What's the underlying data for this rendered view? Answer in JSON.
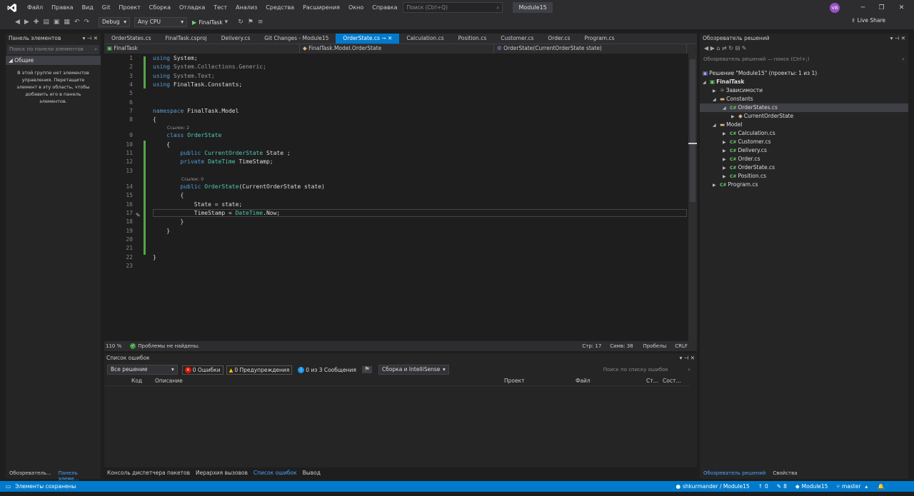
{
  "menu": [
    "Файл",
    "Правка",
    "Вид",
    "Git",
    "Проект",
    "Сборка",
    "Отладка",
    "Тест",
    "Анализ",
    "Средства",
    "Расширения",
    "Окно",
    "Справка"
  ],
  "search_placeholder": "Поиск (Ctrl+Q)",
  "solution_name": "Module15",
  "user_initials": "VB",
  "toolbar": {
    "config": "Debug",
    "platform": "Any CPU",
    "run_target": "FinalTask",
    "live_share": "Live Share"
  },
  "toolbox": {
    "title": "Панель элементов",
    "search_placeholder": "Поиск по панели элементов",
    "group": "Общие",
    "empty_msg": "В этой группе нет элементов управления. Перетащите элемент в эту область, чтобы добавить его в панель элементов.",
    "bottom_tabs": [
      "Обозреватель...",
      "Панель элеме..."
    ]
  },
  "tabs": [
    "OrderStates.cs",
    "FinalTask.csproj",
    "Delivery.cs",
    "Git Changes - Module15",
    "OrderState.cs",
    "Calculation.cs",
    "Position.cs",
    "Customer.cs",
    "Order.cs",
    "Program.cs"
  ],
  "active_tab_index": 4,
  "navbar": {
    "project": "FinalTask",
    "type": "FinalTask.Model.OrderState",
    "member": "OrderState(CurrentOrderState state)"
  },
  "code_lens": {
    "refs2": "Ссылок: 2",
    "refs0": "Ссылок: 0"
  },
  "code": {
    "l1": "System;",
    "l2": "System.Collections.Generic;",
    "l3": "System.Text;",
    "l4": "FinalTask.Constants;",
    "l7": "FinalTask.Model",
    "l9": "OrderState",
    "l11": "State ;",
    "l12": "TimeStamp;",
    "l14": "(CurrentOrderState state)",
    "l16": "State = state;",
    "l17a": "TimeStamp = ",
    "l17b": ".Now;"
  },
  "editor_status": {
    "zoom": "110 %",
    "problems": "Проблемы не найдены.",
    "line": "Стр: 17",
    "col": "Симв: 38",
    "spaces": "Пробелы",
    "eol": "CRLF"
  },
  "error_list": {
    "title": "Список ошибок",
    "scope": "Все решение",
    "errors": "0 Ошибки",
    "warnings": "0 Предупреждения",
    "messages": "0 из 3 Сообщения",
    "build": "Сборка и IntelliSense",
    "search_placeholder": "Поиск по списку ошибок",
    "columns": [
      "Код",
      "Описание",
      "Проект",
      "Файл",
      "Ст...",
      "Сост..."
    ]
  },
  "bottom_tabs": [
    "Консоль диспетчера пакетов",
    "Иерархия вызовов",
    "Список ошибок",
    "Вывод"
  ],
  "solution_explorer": {
    "title": "Обозреватель решений",
    "search_placeholder": "Обозреватель решений — поиск (Ctrl+;)",
    "solution": "Решение \"Module15\" (проекты: 1 из 1)",
    "project": "FinalTask",
    "deps": "Зависимости",
    "constants": "Constants",
    "orderstates": "OrderStates.cs",
    "currentorderstate": "CurrentOrderState",
    "model": "Model",
    "model_files": [
      "Calculation.cs",
      "Customer.cs",
      "Delivery.cs",
      "Order.cs",
      "OrderState.cs",
      "Position.cs"
    ],
    "program": "Program.cs",
    "bottom_tabs": [
      "Обозреватель решений",
      "Свойства"
    ]
  },
  "status": {
    "saved": "Элементы сохранены",
    "repo": "shkurmander / Module15",
    "up": "0",
    "pencil": "8",
    "module": "Module15",
    "branch": "master"
  }
}
